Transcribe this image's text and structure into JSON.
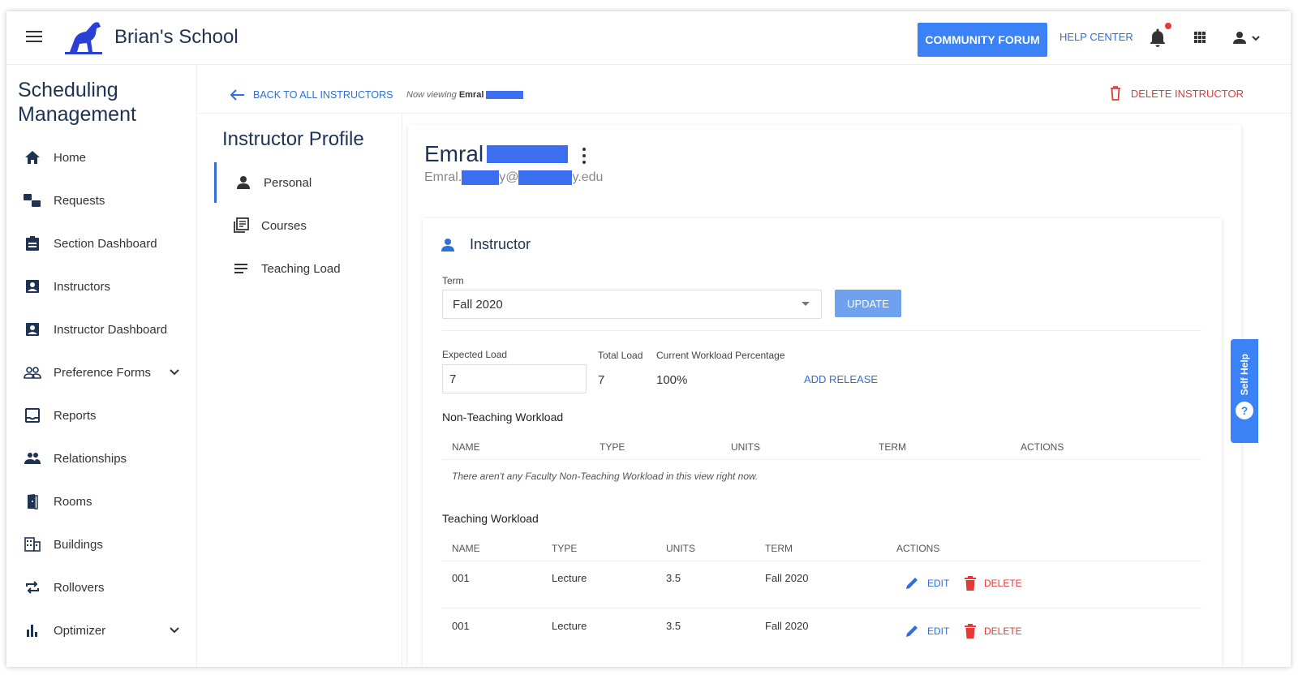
{
  "header": {
    "school_name": "Brian's School",
    "community_forum": "COMMUNITY FORUM",
    "help_center": "HELP CENTER"
  },
  "sidenav": {
    "title": "Scheduling Management",
    "items": [
      {
        "label": "Home",
        "icon": "home-icon"
      },
      {
        "label": "Requests",
        "icon": "thumbs-icon"
      },
      {
        "label": "Section Dashboard",
        "icon": "clipboard-icon"
      },
      {
        "label": "Instructors",
        "icon": "contact-card-icon"
      },
      {
        "label": "Instructor Dashboard",
        "icon": "contact-card-icon"
      },
      {
        "label": "Preference Forms",
        "icon": "people-outline-icon"
      },
      {
        "label": "Reports",
        "icon": "inbox-icon"
      },
      {
        "label": "Relationships",
        "icon": "people-icon"
      },
      {
        "label": "Rooms",
        "icon": "door-icon"
      },
      {
        "label": "Buildings",
        "icon": "building-icon"
      },
      {
        "label": "Rollovers",
        "icon": "repeat-icon"
      },
      {
        "label": "Optimizer",
        "icon": "bar-chart-icon"
      }
    ]
  },
  "breadcrumb": {
    "back_label": "BACK TO ALL INSTRUCTORS",
    "now_viewing_prefix": "Now viewing",
    "now_viewing_name": "Emral",
    "delete_instructor": "DELETE INSTRUCTOR"
  },
  "profile_nav": {
    "title": "Instructor Profile",
    "items": [
      {
        "label": "Personal",
        "active": true
      },
      {
        "label": "Courses",
        "active": false
      },
      {
        "label": "Teaching Load",
        "active": false
      }
    ]
  },
  "instructor": {
    "first_name": "Emral",
    "email_prefix": "Emral.",
    "email_at": "y@",
    "email_suffix": "y.edu"
  },
  "section": {
    "title": "Instructor",
    "term_label": "Term",
    "term_value": "Fall 2020",
    "update_label": "UPDATE",
    "expected_load_label": "Expected Load",
    "expected_load_value": "7",
    "total_load_label": "Total Load",
    "total_load_value": "7",
    "workload_pct_label": "Current Workload Percentage",
    "workload_pct_value": "100%",
    "add_release": "ADD RELEASE"
  },
  "non_teaching": {
    "title": "Non-Teaching Workload",
    "columns": [
      "NAME",
      "TYPE",
      "UNITS",
      "TERM",
      "ACTIONS"
    ],
    "empty_message": "There aren't any Faculty Non-Teaching Workload in this view right now."
  },
  "teaching": {
    "title": "Teaching Workload",
    "columns": [
      "NAME",
      "TYPE",
      "UNITS",
      "TERM",
      "ACTIONS"
    ],
    "rows": [
      {
        "name": "001",
        "type": "Lecture",
        "units": "3.5",
        "term": "Fall 2020"
      },
      {
        "name": "001",
        "type": "Lecture",
        "units": "3.5",
        "term": "Fall 2020"
      }
    ],
    "edit_label": "EDIT",
    "delete_label": "DELETE"
  },
  "self_help": {
    "label": "Self Help",
    "glyph": "?"
  },
  "colors": {
    "accent": "#3b82f6",
    "danger": "#e53935",
    "heading": "#1e3354"
  }
}
